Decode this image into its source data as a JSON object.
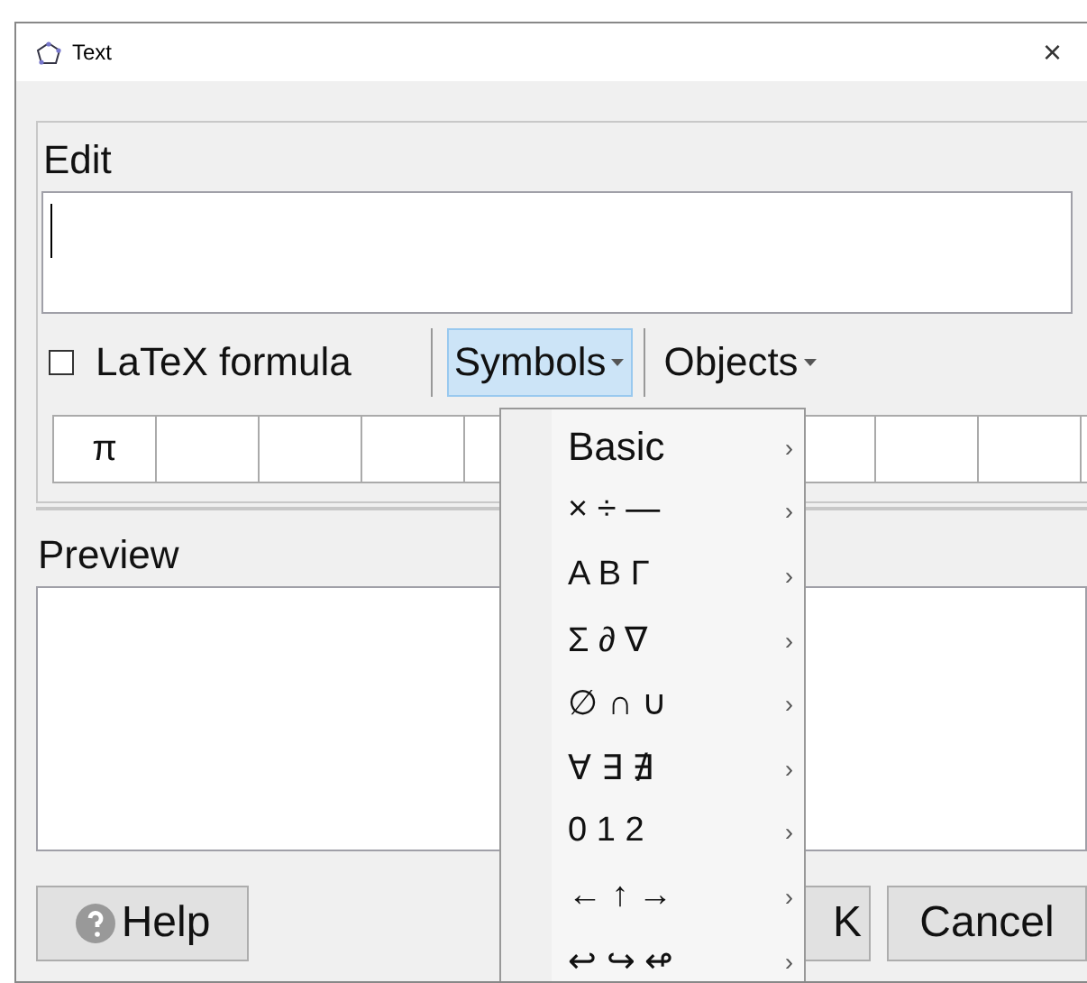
{
  "window": {
    "title": "Text",
    "close": "×"
  },
  "edit": {
    "label": "Edit"
  },
  "toolbar": {
    "latex": {
      "label": "LaTeX formula",
      "checked": false
    },
    "menus": [
      {
        "label": "Symbols",
        "selected": true
      },
      {
        "label": "Objects",
        "selected": false
      }
    ]
  },
  "symbol_table": {
    "cells": [
      "π"
    ]
  },
  "preview": {
    "label": "Preview"
  },
  "buttons": [
    {
      "kind": "help",
      "label": "Help"
    },
    {
      "kind": "ok",
      "label": "K"
    },
    {
      "kind": "cancel",
      "label": "Cancel"
    }
  ],
  "symbols_menu": {
    "items": [
      {
        "label": "Basic",
        "arrow": "›"
      },
      {
        "label": "× ÷ —",
        "arrow": "›"
      },
      {
        "label": "A B Γ",
        "arrow": "›"
      },
      {
        "label": "Σ ∂ ∇",
        "arrow": "›"
      },
      {
        "label": "∅ ∩ ∪",
        "arrow": "›"
      },
      {
        "label": "∀ ∃ ∄",
        "arrow": "›"
      },
      {
        "label": "0 1 2",
        "arrow": "›"
      },
      {
        "label": "← ↑ →",
        "arrow": "›"
      },
      {
        "label": "↩ ↪ ↫",
        "arrow": "›"
      }
    ]
  }
}
